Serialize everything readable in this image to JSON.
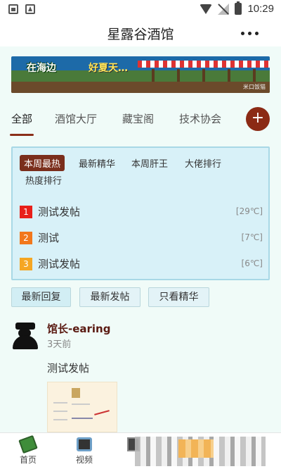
{
  "status_bar": {
    "time": "10:29"
  },
  "header": {
    "title": "星露谷酒馆"
  },
  "banner": {
    "text_left": "在海边",
    "text_right": "好夏天…",
    "watermark": "米口饭猫"
  },
  "tabs": [
    {
      "label": "全部",
      "active": true
    },
    {
      "label": "酒馆大厅",
      "active": false
    },
    {
      "label": "藏宝阁",
      "active": false
    },
    {
      "label": "技术协会",
      "active": false
    }
  ],
  "add_button": "+",
  "ranking": {
    "tabs": [
      "本周最热",
      "最新精华",
      "本周肝王",
      "大佬排行",
      "热度排行"
    ],
    "active_tab": "本周最热",
    "items": [
      {
        "rank": "1",
        "title": "测试发帖",
        "heat": "[29℃]",
        "color": "#e8201a"
      },
      {
        "rank": "2",
        "title": "测试",
        "heat": "[7℃]",
        "color": "#f2781c"
      },
      {
        "rank": "3",
        "title": "测试发帖",
        "heat": "[6℃]",
        "color": "#f5a623"
      }
    ]
  },
  "filters": [
    "最新回复",
    "最新发帖",
    "只看精华"
  ],
  "post": {
    "author": "馆长-earing",
    "time": "3天前",
    "content": "测试发帖"
  },
  "bottom_nav": [
    {
      "label": "首页"
    },
    {
      "label": "视频"
    }
  ]
}
